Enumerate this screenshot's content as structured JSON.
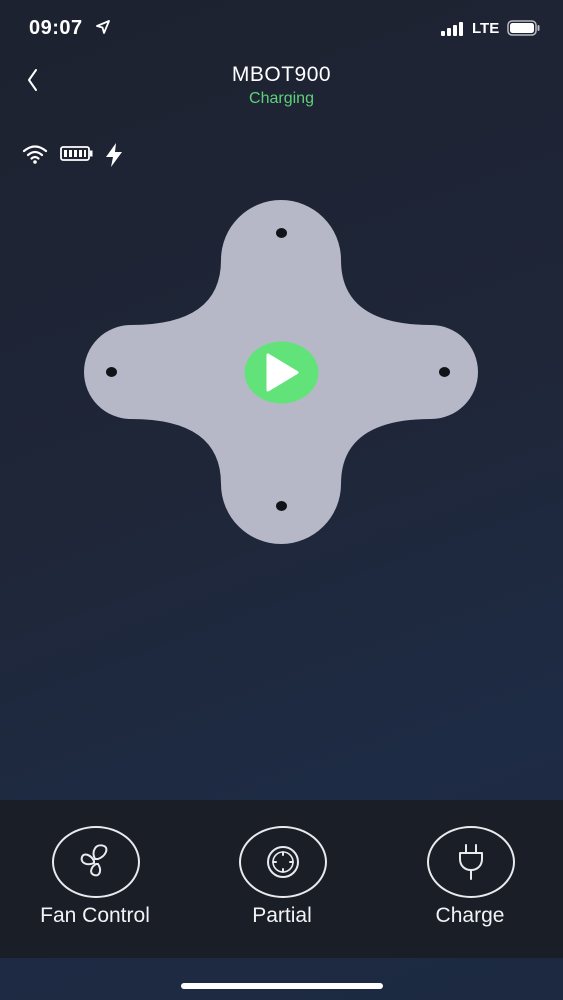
{
  "status_bar": {
    "time": "09:07",
    "network": "LTE",
    "icons": [
      "location-arrow-icon",
      "signal-icon",
      "battery-icon"
    ]
  },
  "header": {
    "back_icon": "chevron-left-icon",
    "device_name": "MBOT900",
    "device_status": "Charging"
  },
  "indicators": [
    "wifi-icon",
    "battery-full-icon",
    "bolt-icon"
  ],
  "controls": {
    "directions": [
      "up",
      "left",
      "right",
      "down"
    ],
    "center_icon": "play-icon"
  },
  "actions": [
    {
      "label": "Fan Control",
      "icon": "fan-icon"
    },
    {
      "label": "Partial",
      "icon": "partial-clean-icon"
    },
    {
      "label": "Charge",
      "icon": "plug-icon"
    }
  ],
  "colors": {
    "accent_green": "#62e37a",
    "status_green": "#5ed17a",
    "dpad_fill": "#b6b8c7",
    "bottom_bar": "#1a1e27"
  }
}
